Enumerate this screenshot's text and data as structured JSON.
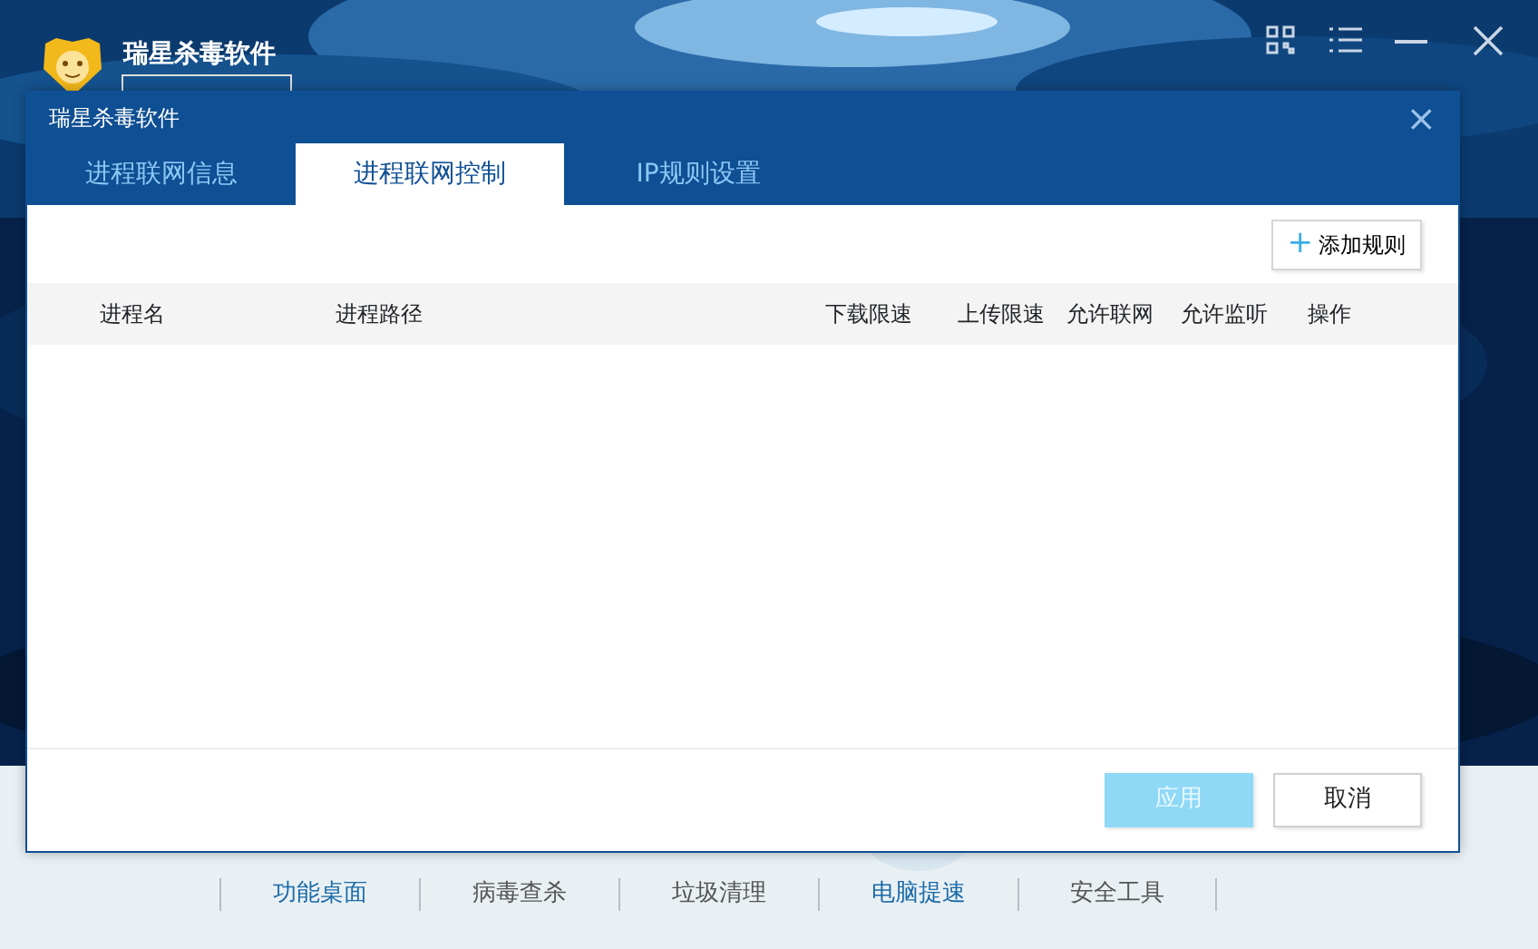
{
  "app": {
    "title": "瑞星杀毒软件"
  },
  "dialog": {
    "title": "瑞星杀毒软件",
    "close": "×",
    "tabs": [
      {
        "label": "进程联网信息",
        "selected": false
      },
      {
        "label": "进程联网控制",
        "selected": true
      },
      {
        "label": "IP规则设置",
        "selected": false
      }
    ],
    "add_button": {
      "icon": "+",
      "label": "添加规则"
    },
    "table": {
      "columns": [
        "进程名",
        "进程路径",
        "下载限速",
        "上传限速",
        "允许联网",
        "允许监听",
        "操作"
      ]
    },
    "buttons": [
      {
        "label": "应用",
        "disabled": true
      },
      {
        "label": "取消",
        "disabled": false
      }
    ]
  },
  "bottom_nav": [
    {
      "label": "功能桌面",
      "selected": false,
      "highlighted": true
    },
    {
      "label": "病毒查杀",
      "selected": false,
      "highlighted": false
    },
    {
      "label": "垃圾清理",
      "selected": false,
      "highlighted": false
    },
    {
      "label": "电脑提速",
      "selected": true,
      "highlighted": true
    },
    {
      "label": "安全工具",
      "selected": false,
      "highlighted": false
    }
  ]
}
